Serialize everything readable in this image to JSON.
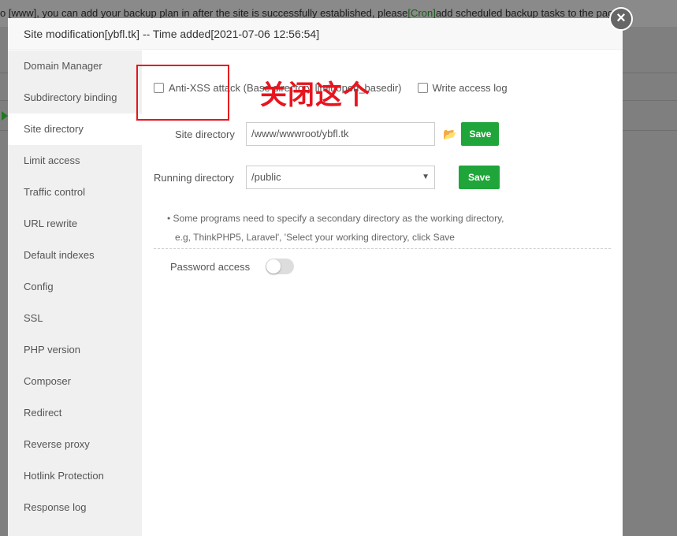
{
  "background": {
    "notice_pre": "o [www], you can add your backup plan in after the site is successfully established, please",
    "notice_link": "[Cron]",
    "notice_post": "add scheduled backup tasks to the page"
  },
  "modal": {
    "title": "Site modification[ybfl.tk] -- Time added[2021-07-06 12:56:54]",
    "close_icon": "close-icon"
  },
  "sidebar": {
    "items": [
      {
        "label": "Domain Manager"
      },
      {
        "label": "Subdirectory binding"
      },
      {
        "label": "Site directory",
        "active": true
      },
      {
        "label": "Limit access"
      },
      {
        "label": "Traffic control"
      },
      {
        "label": "URL rewrite"
      },
      {
        "label": "Default indexes"
      },
      {
        "label": "Config"
      },
      {
        "label": "SSL"
      },
      {
        "label": "PHP version"
      },
      {
        "label": "Composer"
      },
      {
        "label": "Redirect"
      },
      {
        "label": "Reverse proxy"
      },
      {
        "label": "Hotlink Protection"
      },
      {
        "label": "Response log"
      }
    ]
  },
  "main": {
    "anti_xss_label": "Anti-XSS attack (Base directory limit open_basedir)",
    "anti_xss_checked": false,
    "write_log_label": "Write access log",
    "write_log_checked": false,
    "site_dir_label": "Site directory",
    "site_dir_value": "/www/wwwroot/ybfl.tk",
    "save": "Save",
    "running_dir_label": "Running directory",
    "running_dir_value": "/public",
    "tip1": "Some programs need to specify a secondary directory as the working directory,",
    "tip2": "e.g, ThinkPHP5, Laravel', 'Select your working directory, click Save",
    "password_label": "Password access",
    "password_enabled": false
  },
  "annotation": {
    "text": "关闭这个",
    "color": "#e8141e"
  },
  "colors": {
    "accent": "#20a53a"
  }
}
